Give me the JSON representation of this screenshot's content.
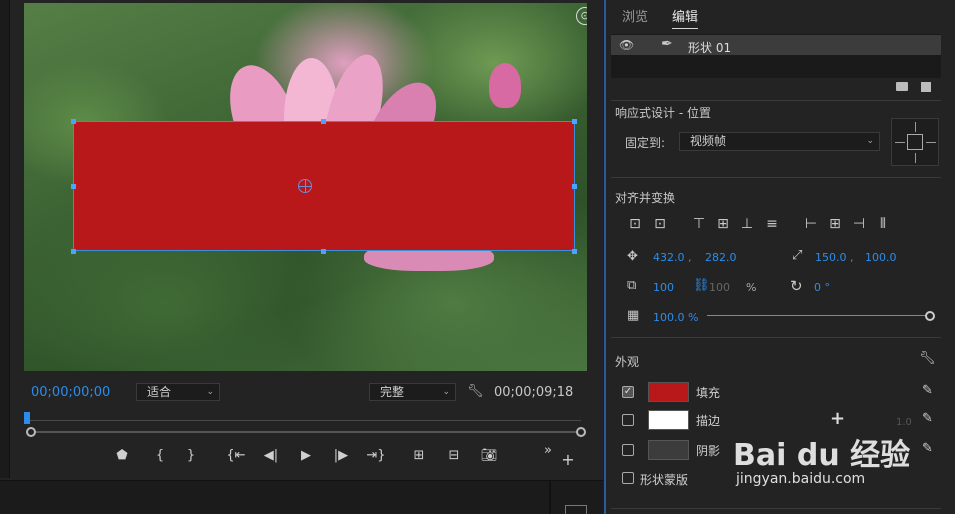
{
  "monitor": {
    "timecode_current": "00;00;00;00",
    "timecode_duration": "00;00;09;18",
    "zoom_select": "适合",
    "quality_select": "完整",
    "transport_buttons": [
      "marker",
      "mark-in",
      "mark-out",
      "go-to-in",
      "step-back",
      "play",
      "step-forward",
      "go-to-out",
      "lift",
      "extract",
      "export-frame"
    ],
    "more_label": "»",
    "add_label": "+"
  },
  "panel": {
    "tabs": [
      "浏览",
      "编辑"
    ],
    "active_tab": "编辑",
    "layer": {
      "name": "形状 01"
    },
    "responsive": {
      "title": "响应式设计 - 位置",
      "pin_label": "固定到:",
      "pin_value": "视频帧"
    },
    "align": {
      "title": "对齐并变换",
      "position_x": "432.0 ,",
      "position_y": "282.0",
      "anchor_x": "150.0 ,",
      "anchor_y": "100.0",
      "scale": "100",
      "scale_linked": "100",
      "scale_unit": "%",
      "rotation": "0 °",
      "opacity": "100.0 %",
      "opacity_value": 1.0
    },
    "appearance": {
      "title": "外观",
      "fill_label": "填充",
      "fill_color": "#b8181a",
      "fill_checked": true,
      "stroke_label": "描边",
      "stroke_color": "#ffffff",
      "stroke_width": "1.0",
      "stroke_checked": false,
      "shadow_label": "阴影",
      "shadow_color": "#3c3c3c",
      "shadow_checked": false,
      "mask_label": "形状蒙版",
      "mask_checked": false
    }
  },
  "watermark": {
    "brand": "Bai du 经验",
    "url": "jingyan.baidu.com"
  }
}
